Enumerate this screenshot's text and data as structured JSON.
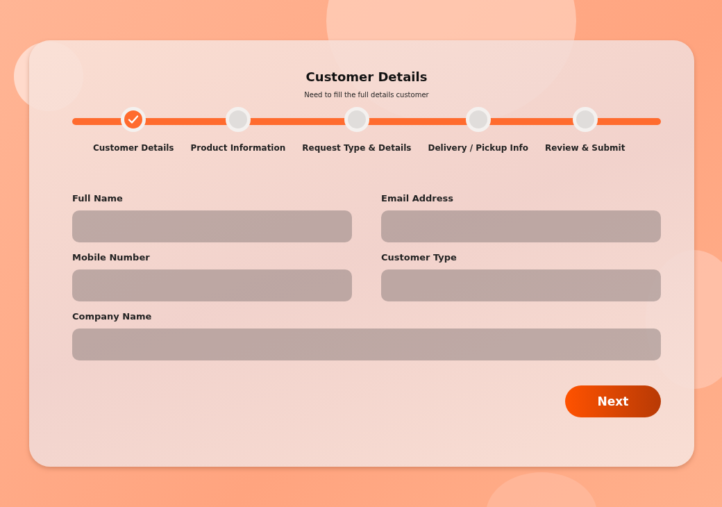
{
  "form": {
    "title": "Customer Details",
    "subtitle": "Need to fill the full details customer"
  },
  "steps": [
    {
      "label": "Customer Details",
      "completed": true
    },
    {
      "label": "Product Information",
      "completed": false
    },
    {
      "label": "Request Type & Details",
      "completed": false
    },
    {
      "label": "Delivery / Pickup Info",
      "completed": false
    },
    {
      "label": "Review & Submit",
      "completed": false
    }
  ],
  "field_rows": [
    [
      {
        "label": "Full Name"
      },
      {
        "label": "Email Address"
      }
    ],
    [
      {
        "label": "Mobile Number"
      },
      {
        "label": "Customer Type"
      }
    ],
    [
      {
        "label": "Company Name"
      }
    ]
  ],
  "next_button": {
    "label": "Next"
  }
}
